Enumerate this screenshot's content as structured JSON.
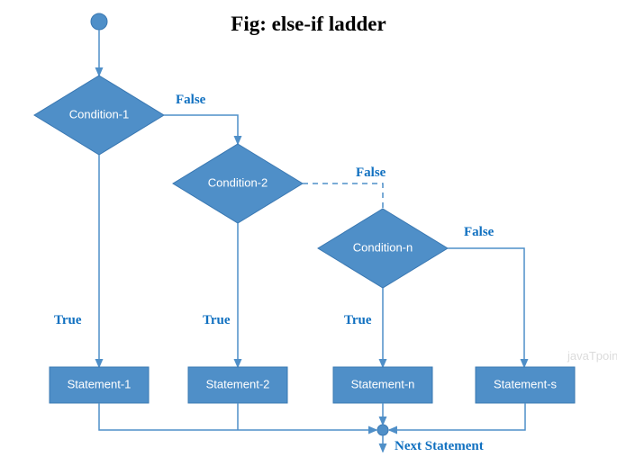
{
  "title": "Fig: else-if ladder",
  "conditions": {
    "c1": "Condition-1",
    "c2": "Condition-2",
    "cn": "Condition-n"
  },
  "statements": {
    "s1": "Statement-1",
    "s2": "Statement-2",
    "sn": "Statement-n",
    "ss": "Statement-s"
  },
  "labels": {
    "true": "True",
    "false": "False",
    "next": "Next Statement"
  },
  "watermark": "javaTpoint"
}
